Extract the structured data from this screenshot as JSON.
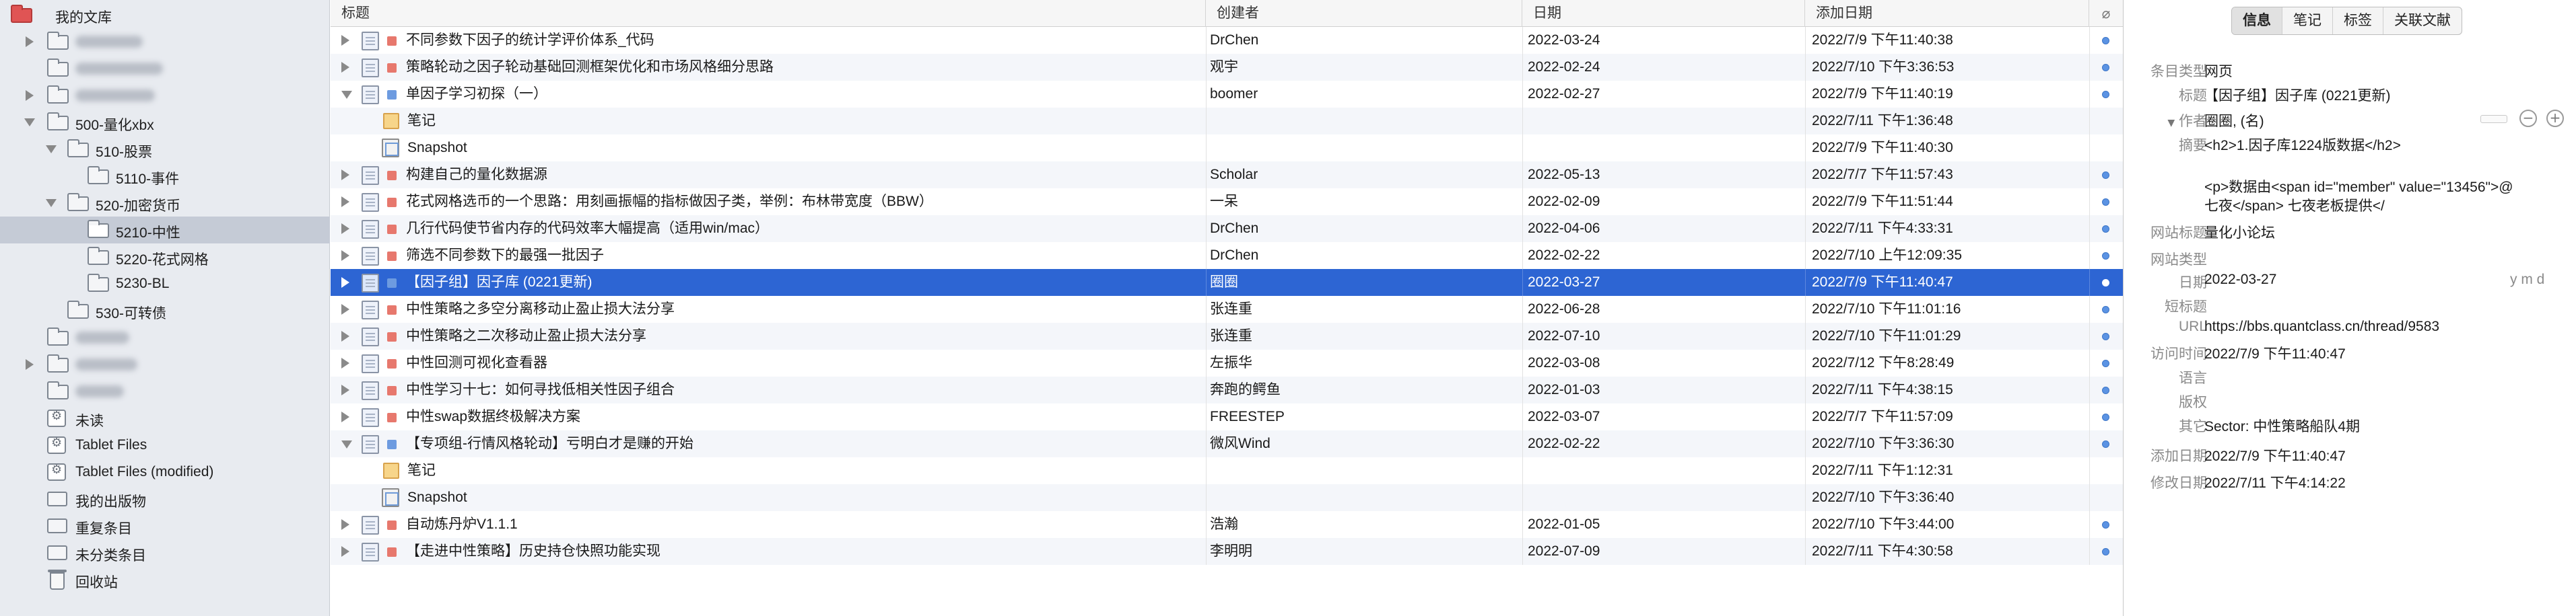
{
  "sidebar": {
    "library_label": "我的文库",
    "quant_folder": "500-量化xbx",
    "folder_510": "510-股票",
    "folder_5110": "5110-事件",
    "folder_520": "520-加密货币",
    "folder_5210": "5210-中性",
    "folder_5220": "5220-花式网格",
    "folder_5230": "5230-BL",
    "folder_530": "530-可转债",
    "unread": "未读",
    "tablet_files": "Tablet Files",
    "tablet_files_modified": "Tablet Files (modified)",
    "my_publications": "我的出版物",
    "duplicates": "重复条目",
    "unfiled": "未分类条目",
    "trash": "回收站"
  },
  "columns": {
    "title": "标题",
    "creator": "创建者",
    "date": "日期",
    "date_added": "添加日期",
    "attachment_icon": "paperclip-icon"
  },
  "rows": [
    {
      "title": "不同参数下因子的统计学评价体系_代码",
      "creator": "DrChen",
      "date": "2022-03-24",
      "added": "2022/7/9 下午11:40:38"
    },
    {
      "title": "策略轮动之因子轮动基础回测框架优化和市场风格细分思路",
      "creator": "观宇",
      "date": "2022-02-24",
      "added": "2022/7/10 下午3:36:53"
    },
    {
      "title": "单因子学习初探（一）",
      "creator": "boomer",
      "date": "2022-02-27",
      "added": "2022/7/9 下午11:40:19"
    },
    {
      "title": "笔记",
      "creator": "",
      "date": "",
      "added": "2022/7/11 下午1:36:48"
    },
    {
      "title": "Snapshot",
      "creator": "",
      "date": "",
      "added": "2022/7/9 下午11:40:30"
    },
    {
      "title": "构建自己的量化数据源",
      "creator": "Scholar",
      "date": "2022-05-13",
      "added": "2022/7/7 下午11:57:43"
    },
    {
      "title": "花式网格选币的一个思路：用刻画振幅的指标做因子类，举例：布林带宽度（BBW）",
      "creator": "一呆",
      "date": "2022-02-09",
      "added": "2022/7/9 下午11:51:44"
    },
    {
      "title": "几行代码使节省内存的代码效率大幅提高（适用win/mac）",
      "creator": "DrChen",
      "date": "2022-04-06",
      "added": "2022/7/11 下午4:33:31"
    },
    {
      "title": "筛选不同参数下的最强一批因子",
      "creator": "DrChen",
      "date": "2022-02-22",
      "added": "2022/7/10 上午12:09:35"
    },
    {
      "title": "【因子组】因子库 (0221更新)",
      "creator": "圈圈",
      "date": "2022-03-27",
      "added": "2022/7/9 下午11:40:47"
    },
    {
      "title": "中性策略之多空分离移动止盈止损大法分享",
      "creator": "张连重",
      "date": "2022-06-28",
      "added": "2022/7/10 下午11:01:16"
    },
    {
      "title": "中性策略之二次移动止盈止损大法分享",
      "creator": "张连重",
      "date": "2022-07-10",
      "added": "2022/7/10 下午11:01:29"
    },
    {
      "title": "中性回测可视化查看器",
      "creator": "左振华",
      "date": "2022-03-08",
      "added": "2022/7/12 下午8:28:49"
    },
    {
      "title": "中性学习十七：如何寻找低相关性因子组合",
      "creator": "奔跑的鳄鱼",
      "date": "2022-01-03",
      "added": "2022/7/11 下午4:38:15"
    },
    {
      "title": "中性swap数据终极解决方案",
      "creator": "FREESTEP",
      "date": "2022-03-07",
      "added": "2022/7/7 下午11:57:09"
    },
    {
      "title": "【专项组-行情风格轮动】亏明白才是赚的开始",
      "creator": "微风Wind",
      "date": "2022-02-22",
      "added": "2022/7/10 下午3:36:30"
    },
    {
      "title": "笔记",
      "creator": "",
      "date": "",
      "added": "2022/7/11 下午1:12:31"
    },
    {
      "title": "Snapshot",
      "creator": "",
      "date": "",
      "added": "2022/7/10 下午3:36:40"
    },
    {
      "title": "自动炼丹炉V1.1.1",
      "creator": "浩瀚",
      "date": "2022-01-05",
      "added": "2022/7/10 下午3:44:00"
    },
    {
      "title": "【走进中性策略】历史持仓快照功能实现",
      "creator": "李明明",
      "date": "2022-07-09",
      "added": "2022/7/11 下午4:30:58"
    }
  ],
  "panel": {
    "tabs": [
      "信息",
      "笔记",
      "标签",
      "关联文献"
    ],
    "item_type_label": "条目类型",
    "item_type": "网页",
    "title_label": "标题",
    "title": "【因子组】因子库 (0221更新)",
    "author_label": "作者",
    "author": "圈圈, (名)",
    "abstract_label": "摘要",
    "abstract_line1": "<h2>1.因子库1224版数据</h2>",
    "abstract_line2": "<p>数据由<span id=\"member\" value=\"13456\">@",
    "abstract_line3": "七夜</span> 七夜老板提供</",
    "website_title_label": "网站标题",
    "website_title": "量化小论坛",
    "website_type_label": "网站类型",
    "date_label": "日期",
    "date": "2022-03-27",
    "date_format": "y m d",
    "short_title_label": "短标题",
    "url_label": "URL",
    "url": "https://bbs.quantclass.cn/thread/9583",
    "accessed_label": "访问时间",
    "accessed": "2022/7/9 下午11:40:47",
    "language_label": "语言",
    "rights_label": "版权",
    "extra_label": "其它",
    "extra": "Sector: 中性策略船队4期",
    "date_added_label": "添加日期",
    "date_added": "2022/7/9 下午11:40:47",
    "date_modified_label": "修改日期",
    "date_modified": "2022/7/11 下午4:14:22"
  }
}
